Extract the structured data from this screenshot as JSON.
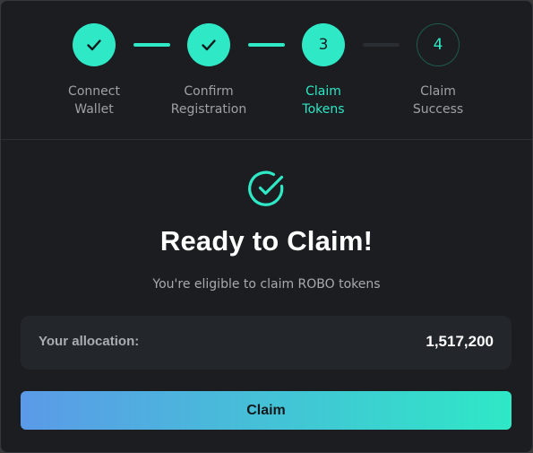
{
  "stepper": {
    "steps": [
      {
        "number": "",
        "label": "Connect\nWallet",
        "state": "done",
        "icon": "checkmark-icon"
      },
      {
        "number": "",
        "label": "Confirm\nRegistration",
        "state": "done",
        "icon": "checkmark-icon"
      },
      {
        "number": "3",
        "label": "Claim\nTokens",
        "state": "active"
      },
      {
        "number": "4",
        "label": "Claim\nSuccess",
        "state": "pending"
      }
    ]
  },
  "hero": {
    "icon": "check-circle-icon",
    "title": "Ready to Claim!",
    "subtitle": "You're eligible to claim ROBO tokens"
  },
  "allocation": {
    "label": "Your allocation:",
    "value": "1,517,200"
  },
  "actions": {
    "claim_label": "Claim"
  },
  "colors": {
    "accent": "#2ee8c6",
    "background": "#1b1d20",
    "panel": "#23262b",
    "button_gradient_start": "#5b9ae8",
    "button_gradient_end": "#2ee8c6"
  }
}
